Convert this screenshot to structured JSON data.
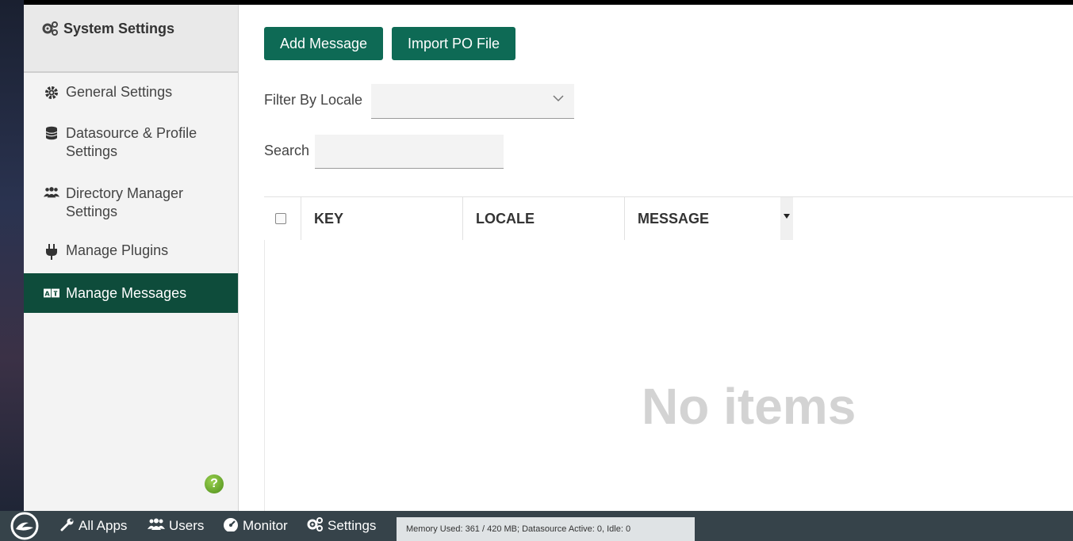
{
  "sidebar": {
    "title": "System Settings",
    "items": [
      {
        "label": "General Settings"
      },
      {
        "label": "Datasource & Profile Settings"
      },
      {
        "label": "Directory Manager Settings"
      },
      {
        "label": "Manage Plugins"
      },
      {
        "label": "Manage Messages",
        "active": true
      }
    ],
    "help_label": "?"
  },
  "main": {
    "buttons": {
      "add": "Add Message",
      "import": "Import PO File"
    },
    "filter_label": "Filter By Locale",
    "filter_value": "",
    "search_label": "Search",
    "search_value": "",
    "table": {
      "columns": [
        "KEY",
        "LOCALE",
        "MESSAGE"
      ],
      "rows": [],
      "empty_text": "No items"
    }
  },
  "bottombar": {
    "items": [
      {
        "label": "All Apps"
      },
      {
        "label": "Users"
      },
      {
        "label": "Monitor"
      },
      {
        "label": "Settings"
      }
    ],
    "status": "Memory Used: 361 / 420 MB; Datasource Active: 0, Idle: 0"
  },
  "colors": {
    "accent": "#0e6a55",
    "active_nav": "#0e4c3b",
    "bottombar": "#36434a"
  }
}
